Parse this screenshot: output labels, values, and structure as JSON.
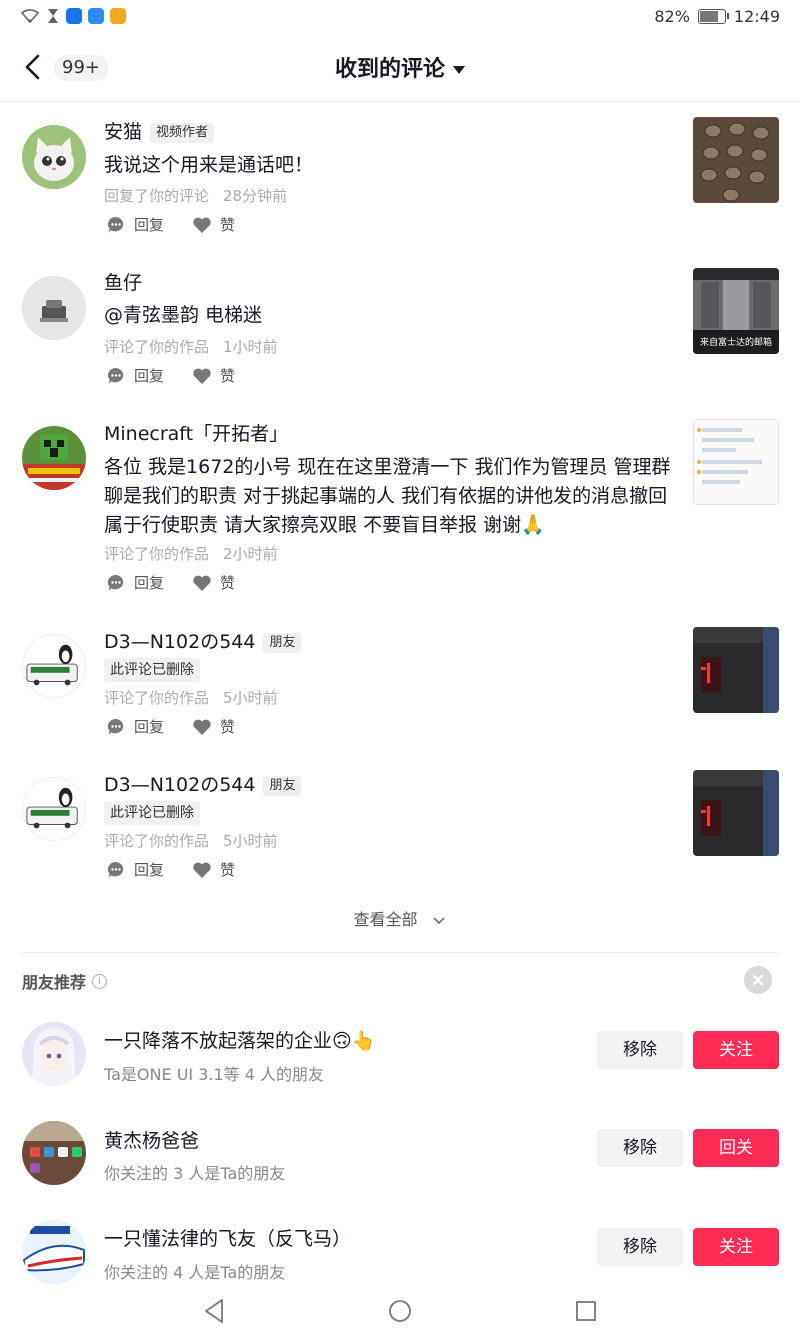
{
  "status_bar": {
    "battery_text": "82%",
    "time": "12:49",
    "battery_level": 0.82
  },
  "header": {
    "back_icon": "chevron-left-icon",
    "badge": "99+",
    "title": "收到的评论",
    "title_dropdown_icon": "caret-down-icon"
  },
  "actions": {
    "reply_label": "回复",
    "like_label": "赞"
  },
  "comments": [
    {
      "name": "安猫",
      "tag": "视频作者",
      "text": "我说这个用来是通话吧！",
      "deleted": "",
      "action_desc": "回复了你的评论",
      "time": "28分钟前",
      "thumb_caption": ""
    },
    {
      "name": "鱼仔",
      "tag": "",
      "text": "@青弦墨韵 电梯迷",
      "deleted": "",
      "action_desc": "评论了你的作品",
      "time": "1小时前",
      "thumb_caption": "来自富士达的邮箱"
    },
    {
      "name": "Minecraft「开拓者」",
      "tag": "",
      "text": "各位 我是1672的小号 现在在这里澄清一下 我们作为管理员 管理群聊是我们的职责 对于挑起事端的人 我们有依据的讲他发的消息撤回 属于行使职责 请大家擦亮双眼 不要盲目举报 谢谢🙏",
      "deleted": "",
      "action_desc": "评论了你的作品",
      "time": "2小时前",
      "thumb_caption": ""
    },
    {
      "name": "D3—N102の544",
      "tag": "朋友",
      "text": "",
      "deleted": "此评论已删除",
      "action_desc": "评论了你的作品",
      "time": "5小时前",
      "thumb_caption": ""
    },
    {
      "name": "D3—N102の544",
      "tag": "朋友",
      "text": "",
      "deleted": "此评论已删除",
      "action_desc": "评论了你的作品",
      "time": "5小时前",
      "thumb_caption": ""
    }
  ],
  "see_all": "查看全部",
  "recommend": {
    "title": "朋友推荐",
    "items": [
      {
        "name": "一只降落不放起落架的企业🙃👆",
        "sub": "Ta是ONE UI 3.1等 4 人的朋友",
        "remove": "移除",
        "follow": "关注"
      },
      {
        "name": "黄杰杨爸爸",
        "sub": "你关注的 3 人是Ta的朋友",
        "remove": "移除",
        "follow": "回关"
      },
      {
        "name": "一只懂法律的飞友（反飞马）",
        "sub": "你关注的 4 人是Ta的朋友",
        "remove": "移除",
        "follow": "关注"
      }
    ]
  },
  "colors": {
    "follow_button": "#fe2c55",
    "primary_text": "#161823",
    "meta_text": "#aaaab0"
  }
}
